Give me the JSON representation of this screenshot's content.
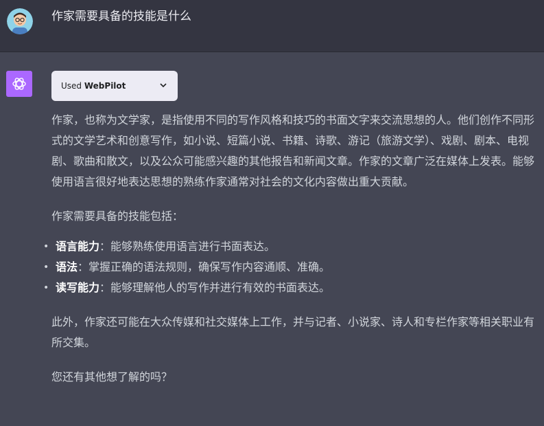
{
  "user_message": {
    "text": "作家需要具备的技能是什么",
    "avatar_icon": "user-avatar-icon"
  },
  "assistant": {
    "avatar_icon": "openai-logo-icon",
    "avatar_color": "#ab68ff",
    "plugin": {
      "prefix": "Used ",
      "name": "WebPilot",
      "chevron_icon": "chevron-down-icon"
    },
    "paragraph1": "作家，也称为文学家，是指使用不同的写作风格和技巧的书面文字来交流思想的人。他们创作不同形式的文学艺术和创意写作，如小说、短篇小说、书籍、诗歌、游记（旅游文学）、戏剧、剧本、电视剧、歌曲和散文，以及公众可能感兴趣的其他报告和新闻文章。作家的文章广泛在媒体上发表。能够使用语言很好地表达思想的熟练作家通常对社会的文化内容做出重大贡献。",
    "paragraph2": "作家需要具备的技能包括：",
    "skills": [
      {
        "name": "语言能力",
        "desc": "：能够熟练使用语言进行书面表达。"
      },
      {
        "name": "语法",
        "desc": "：掌握正确的语法规则，确保写作内容通顺、准确。"
      },
      {
        "name": "读写能力",
        "desc": "：能够理解他人的写作并进行有效的书面表达。"
      }
    ],
    "paragraph3": "此外，作家还可能在大众传媒和社交媒体上工作，并与记者、小说家、诗人和专栏作家等相关职业有所交集。",
    "paragraph4": "您还有其他想了解的吗？"
  }
}
